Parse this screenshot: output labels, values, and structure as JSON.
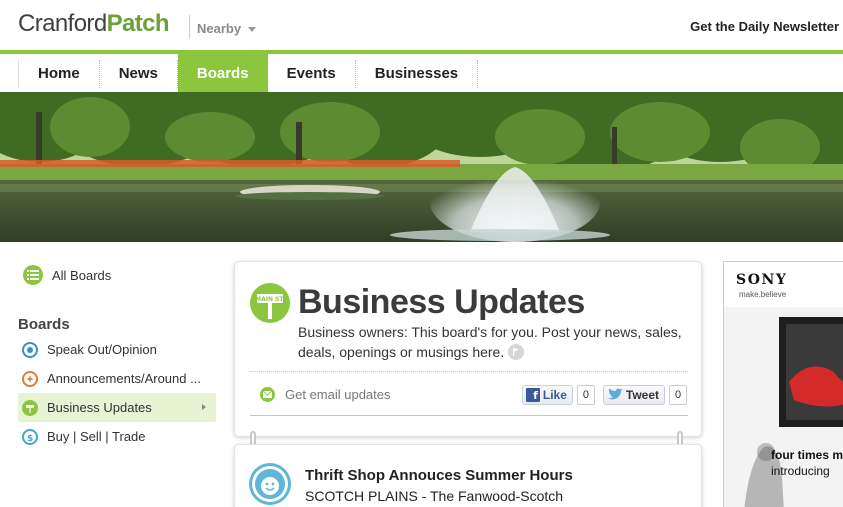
{
  "header": {
    "logo_town": "Cranford",
    "logo_patch": "Patch",
    "nearby_label": "Nearby",
    "newsletter_label": "Get the Daily Newsletter"
  },
  "nav": {
    "items": [
      {
        "label": "Home"
      },
      {
        "label": "News"
      },
      {
        "label": "Boards"
      },
      {
        "label": "Events"
      },
      {
        "label": "Businesses"
      }
    ],
    "active": "Boards"
  },
  "sidebar": {
    "all_boards_label": "All Boards",
    "boards_heading": "Boards",
    "items": [
      {
        "label": "Speak Out/Opinion",
        "icon": "speech-icon",
        "color": "#3a8fc8"
      },
      {
        "label": "Announcements/Around ...",
        "icon": "starburst-icon",
        "color": "#e07b39"
      },
      {
        "label": "Business Updates",
        "icon": "main-st-sign-icon",
        "color": "#8cc63f",
        "active": true
      },
      {
        "label": "Buy | Sell | Trade",
        "icon": "dollar-icon",
        "color": "#4aa3c8"
      }
    ]
  },
  "board": {
    "sign_text": "MAIN ST.",
    "title": "Business Updates",
    "description": "Business owners: This board's for you. Post your news, sales, deals, openings or musings here.",
    "email_updates_label": "Get email updates",
    "like_label": "Like",
    "like_count": "0",
    "tweet_label": "Tweet",
    "tweet_count": "0"
  },
  "article": {
    "title": "Thrift Shop Annouces Summer Hours",
    "meta": "SCOTCH PLAINS  -  The Fanwood-Scotch"
  },
  "ad": {
    "brand": "SONY",
    "tagline": "make.believe",
    "headline": "four times m",
    "subline": "introducing"
  },
  "colors": {
    "accent": "#8cc63f",
    "brand_green": "#6aa13a",
    "facebook": "#3b5998"
  }
}
